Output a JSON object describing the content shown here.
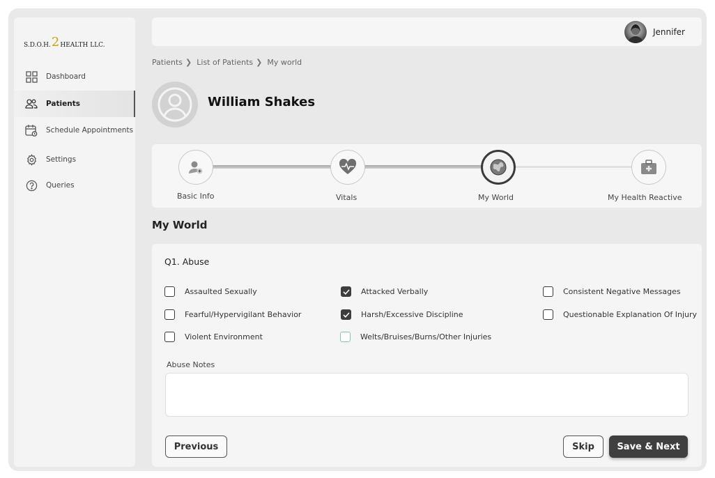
{
  "brand": {
    "prefix": "S.D.O.H.",
    "number": "2",
    "suffix": "HEALTH LLC."
  },
  "sidebar": {
    "items": [
      {
        "label": "Dashboard",
        "icon": "grid-icon"
      },
      {
        "label": "Patients",
        "icon": "users-icon",
        "active": true
      },
      {
        "label": "Schedule Appointments",
        "icon": "calendar-icon"
      },
      {
        "label": "Settings",
        "icon": "gear-icon"
      },
      {
        "label": "Queries",
        "icon": "question-icon"
      }
    ]
  },
  "topbar": {
    "user_name": "Jennifer"
  },
  "breadcrumb": [
    "Patients",
    "List of Patients",
    "My world"
  ],
  "patient": {
    "name": "William Shakes"
  },
  "stepper": {
    "steps": [
      {
        "label": "Basic Info",
        "icon": "user-plus-icon"
      },
      {
        "label": "Vitals",
        "icon": "heartbeat-icon"
      },
      {
        "label": "My World",
        "icon": "globe-icon",
        "current": true
      },
      {
        "label": "My Health Reactive",
        "icon": "medical-kit-icon"
      }
    ]
  },
  "section_title": "My World",
  "question": {
    "title": "Q1. Abuse",
    "options": [
      {
        "label": "Assaulted Sexually",
        "checked": false
      },
      {
        "label": "Attacked Verbally",
        "checked": true
      },
      {
        "label": "Consistent Negative Messages",
        "checked": false
      },
      {
        "label": "Fearful/Hypervigilant Behavior",
        "checked": false
      },
      {
        "label": "Harsh/Excessive Discipline",
        "checked": true
      },
      {
        "label": "Questionable Explanation Of Injury",
        "checked": false
      },
      {
        "label": "Violent Environment",
        "checked": false
      },
      {
        "label": "Welts/Bruises/Burns/Other Injuries",
        "checked": false
      }
    ],
    "notes_label": "Abuse Notes",
    "notes_value": ""
  },
  "actions": {
    "previous": "Previous",
    "skip": "Skip",
    "save_next": "Save & Next"
  },
  "colors": {
    "accent_gold": "#c9a20a",
    "dark_button": "#3f3f3f",
    "focus_teal": "#7cc8b4"
  }
}
